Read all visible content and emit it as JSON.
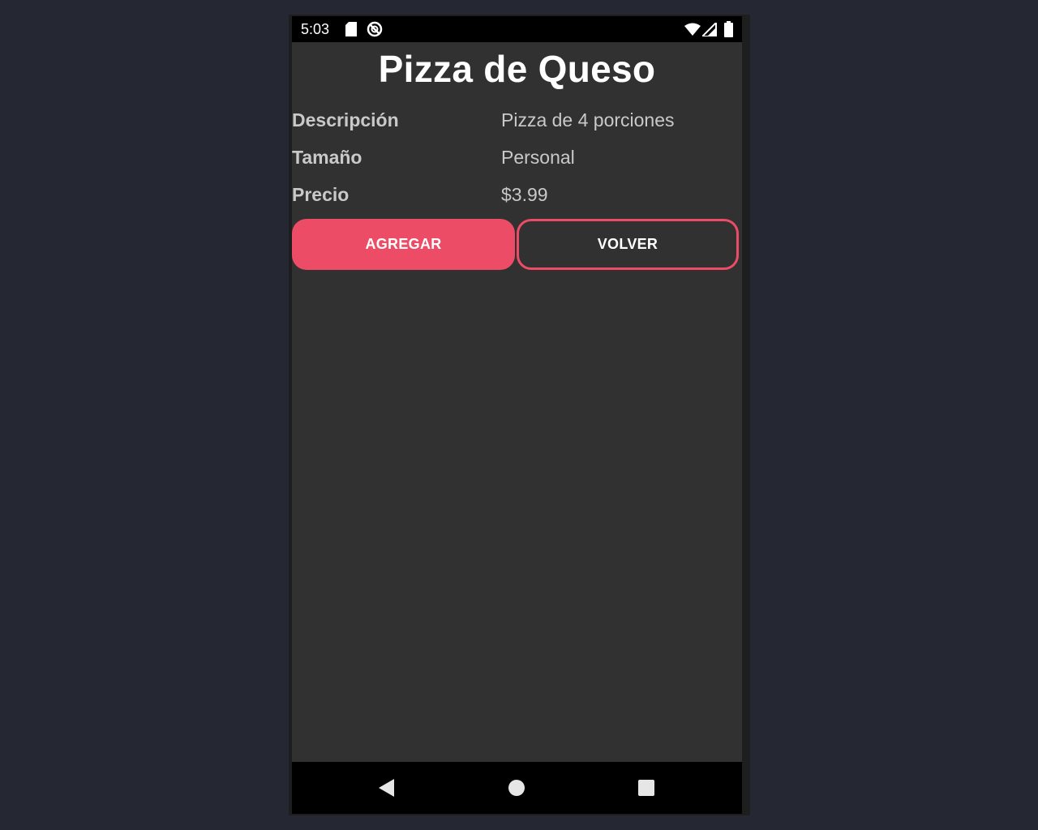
{
  "status_bar": {
    "time": "5:03",
    "icons": [
      "sd-card-icon",
      "no-disturb-icon",
      "wifi-icon",
      "cell-signal-icon",
      "battery-icon"
    ]
  },
  "product": {
    "title": "Pizza de Queso",
    "details": [
      {
        "label": "Descripción",
        "value": "Pizza de 4 porciones"
      },
      {
        "label": "Tamaño",
        "value": "Personal"
      },
      {
        "label": "Precio",
        "value": "$3.99"
      }
    ]
  },
  "actions": {
    "add_label": "AGREGAR",
    "back_label": "VOLVER"
  },
  "nav_bar": {
    "icons": [
      "back-triangle-icon",
      "home-circle-icon",
      "recents-square-icon"
    ]
  },
  "colors": {
    "accent": "#ec4c65",
    "background": "#313131",
    "page_background": "#252733",
    "text_muted": "#c9c9c9"
  }
}
